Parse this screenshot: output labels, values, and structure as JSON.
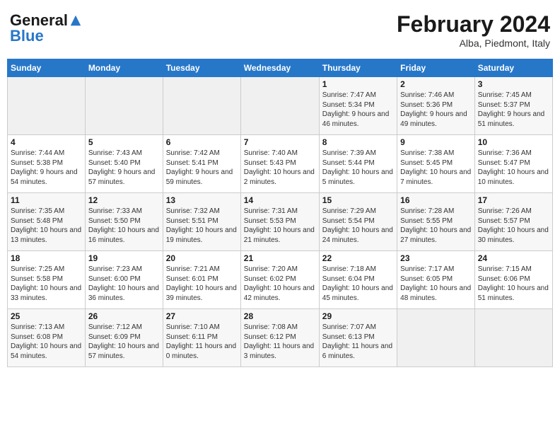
{
  "header": {
    "logo_general": "General",
    "logo_blue": "Blue",
    "month_title": "February 2024",
    "location": "Alba, Piedmont, Italy"
  },
  "calendar": {
    "days_of_week": [
      "Sunday",
      "Monday",
      "Tuesday",
      "Wednesday",
      "Thursday",
      "Friday",
      "Saturday"
    ],
    "weeks": [
      [
        {
          "day": "",
          "info": ""
        },
        {
          "day": "",
          "info": ""
        },
        {
          "day": "",
          "info": ""
        },
        {
          "day": "",
          "info": ""
        },
        {
          "day": "1",
          "info": "Sunrise: 7:47 AM\nSunset: 5:34 PM\nDaylight: 9 hours and 46 minutes."
        },
        {
          "day": "2",
          "info": "Sunrise: 7:46 AM\nSunset: 5:36 PM\nDaylight: 9 hours and 49 minutes."
        },
        {
          "day": "3",
          "info": "Sunrise: 7:45 AM\nSunset: 5:37 PM\nDaylight: 9 hours and 51 minutes."
        }
      ],
      [
        {
          "day": "4",
          "info": "Sunrise: 7:44 AM\nSunset: 5:38 PM\nDaylight: 9 hours and 54 minutes."
        },
        {
          "day": "5",
          "info": "Sunrise: 7:43 AM\nSunset: 5:40 PM\nDaylight: 9 hours and 57 minutes."
        },
        {
          "day": "6",
          "info": "Sunrise: 7:42 AM\nSunset: 5:41 PM\nDaylight: 9 hours and 59 minutes."
        },
        {
          "day": "7",
          "info": "Sunrise: 7:40 AM\nSunset: 5:43 PM\nDaylight: 10 hours and 2 minutes."
        },
        {
          "day": "8",
          "info": "Sunrise: 7:39 AM\nSunset: 5:44 PM\nDaylight: 10 hours and 5 minutes."
        },
        {
          "day": "9",
          "info": "Sunrise: 7:38 AM\nSunset: 5:45 PM\nDaylight: 10 hours and 7 minutes."
        },
        {
          "day": "10",
          "info": "Sunrise: 7:36 AM\nSunset: 5:47 PM\nDaylight: 10 hours and 10 minutes."
        }
      ],
      [
        {
          "day": "11",
          "info": "Sunrise: 7:35 AM\nSunset: 5:48 PM\nDaylight: 10 hours and 13 minutes."
        },
        {
          "day": "12",
          "info": "Sunrise: 7:33 AM\nSunset: 5:50 PM\nDaylight: 10 hours and 16 minutes."
        },
        {
          "day": "13",
          "info": "Sunrise: 7:32 AM\nSunset: 5:51 PM\nDaylight: 10 hours and 19 minutes."
        },
        {
          "day": "14",
          "info": "Sunrise: 7:31 AM\nSunset: 5:53 PM\nDaylight: 10 hours and 21 minutes."
        },
        {
          "day": "15",
          "info": "Sunrise: 7:29 AM\nSunset: 5:54 PM\nDaylight: 10 hours and 24 minutes."
        },
        {
          "day": "16",
          "info": "Sunrise: 7:28 AM\nSunset: 5:55 PM\nDaylight: 10 hours and 27 minutes."
        },
        {
          "day": "17",
          "info": "Sunrise: 7:26 AM\nSunset: 5:57 PM\nDaylight: 10 hours and 30 minutes."
        }
      ],
      [
        {
          "day": "18",
          "info": "Sunrise: 7:25 AM\nSunset: 5:58 PM\nDaylight: 10 hours and 33 minutes."
        },
        {
          "day": "19",
          "info": "Sunrise: 7:23 AM\nSunset: 6:00 PM\nDaylight: 10 hours and 36 minutes."
        },
        {
          "day": "20",
          "info": "Sunrise: 7:21 AM\nSunset: 6:01 PM\nDaylight: 10 hours and 39 minutes."
        },
        {
          "day": "21",
          "info": "Sunrise: 7:20 AM\nSunset: 6:02 PM\nDaylight: 10 hours and 42 minutes."
        },
        {
          "day": "22",
          "info": "Sunrise: 7:18 AM\nSunset: 6:04 PM\nDaylight: 10 hours and 45 minutes."
        },
        {
          "day": "23",
          "info": "Sunrise: 7:17 AM\nSunset: 6:05 PM\nDaylight: 10 hours and 48 minutes."
        },
        {
          "day": "24",
          "info": "Sunrise: 7:15 AM\nSunset: 6:06 PM\nDaylight: 10 hours and 51 minutes."
        }
      ],
      [
        {
          "day": "25",
          "info": "Sunrise: 7:13 AM\nSunset: 6:08 PM\nDaylight: 10 hours and 54 minutes."
        },
        {
          "day": "26",
          "info": "Sunrise: 7:12 AM\nSunset: 6:09 PM\nDaylight: 10 hours and 57 minutes."
        },
        {
          "day": "27",
          "info": "Sunrise: 7:10 AM\nSunset: 6:11 PM\nDaylight: 11 hours and 0 minutes."
        },
        {
          "day": "28",
          "info": "Sunrise: 7:08 AM\nSunset: 6:12 PM\nDaylight: 11 hours and 3 minutes."
        },
        {
          "day": "29",
          "info": "Sunrise: 7:07 AM\nSunset: 6:13 PM\nDaylight: 11 hours and 6 minutes."
        },
        {
          "day": "",
          "info": ""
        },
        {
          "day": "",
          "info": ""
        }
      ]
    ]
  }
}
